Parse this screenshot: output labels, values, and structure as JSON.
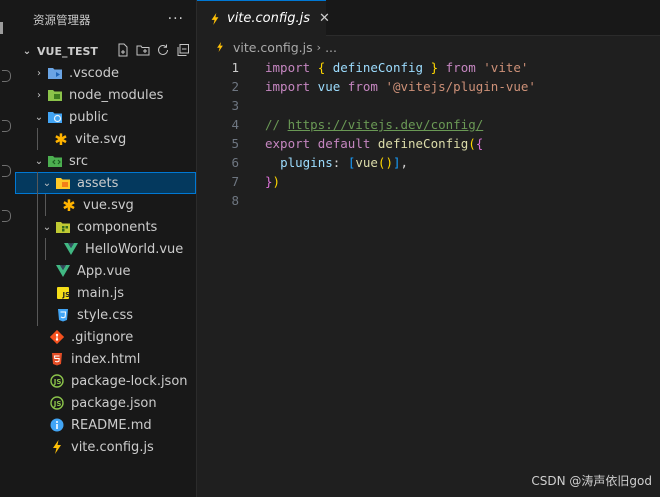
{
  "explorer": {
    "title": "资源管理器",
    "more": "···",
    "root": "VUE_TEST",
    "items": [
      {
        "label": ".vscode",
        "icon": "vscode-folder-icon",
        "chevron": "›",
        "depth": 1
      },
      {
        "label": "node_modules",
        "icon": "folder-icon",
        "chevron": "›",
        "depth": 1
      },
      {
        "label": "public",
        "icon": "public-folder-icon",
        "chevron": "⌄",
        "depth": 1
      },
      {
        "label": "vite.svg",
        "icon": "svg-file-icon",
        "chevron": "",
        "depth": 2
      },
      {
        "label": "src",
        "icon": "src-folder-icon",
        "chevron": "⌄",
        "depth": 1
      },
      {
        "label": "assets",
        "icon": "assets-folder-icon",
        "chevron": "⌄",
        "depth": 2
      },
      {
        "label": "vue.svg",
        "icon": "svg-file-icon",
        "chevron": "",
        "depth": 3
      },
      {
        "label": "components",
        "icon": "components-folder-icon",
        "chevron": "⌄",
        "depth": 2
      },
      {
        "label": "HelloWorld.vue",
        "icon": "vue-file-icon",
        "chevron": "",
        "depth": 3
      },
      {
        "label": "App.vue",
        "icon": "vue-file-icon",
        "chevron": "",
        "depth": 2
      },
      {
        "label": "main.js",
        "icon": "js-file-icon",
        "chevron": "",
        "depth": 2
      },
      {
        "label": "style.css",
        "icon": "css-file-icon",
        "chevron": "",
        "depth": 2
      },
      {
        "label": ".gitignore",
        "icon": "git-file-icon",
        "chevron": "",
        "depth": 1
      },
      {
        "label": "index.html",
        "icon": "html-file-icon",
        "chevron": "",
        "depth": 1
      },
      {
        "label": "package-lock.json",
        "icon": "json-file-icon",
        "chevron": "",
        "depth": 1
      },
      {
        "label": "package.json",
        "icon": "json-file-icon",
        "chevron": "",
        "depth": 1
      },
      {
        "label": "README.md",
        "icon": "info-file-icon",
        "chevron": "",
        "depth": 1
      },
      {
        "label": "vite.config.js",
        "icon": "vite-file-icon",
        "chevron": "",
        "depth": 1
      }
    ]
  },
  "editor": {
    "tab_label": "vite.config.js",
    "tab_close": "✕",
    "breadcrumb_file": "vite.config.js",
    "breadcrumb_sep": "›",
    "breadcrumb_more": "...",
    "line_numbers": [
      "1",
      "2",
      "3",
      "4",
      "5",
      "6",
      "7",
      "8"
    ],
    "code": {
      "l1_import": "import",
      "l1_ob": "{",
      "l1_name": " defineConfig ",
      "l1_cb": "}",
      "l1_from": "from",
      "l1_str": "'vite'",
      "l2_import": "import",
      "l2_name": " vue ",
      "l2_from": "from",
      "l2_str": "'@vitejs/plugin-vue'",
      "l4_slashes": "// ",
      "l4_url": "https://vitejs.dev/config/",
      "l5_export": "export",
      "l5_default": "default",
      "l5_fn": "defineConfig",
      "l5_op": "(",
      "l5_ob": "{",
      "l6_key": "plugins",
      "l6_colon": ": ",
      "l6_ob": "[",
      "l6_fn": "vue",
      "l6_parens": "()",
      "l6_cb": "]",
      "l6_comma": ",",
      "l7_cb": "}",
      "l7_cp": ")"
    }
  },
  "watermark": "CSDN @涛声依旧god",
  "colors": {
    "accent": "#0078d4",
    "selected_bg": "#04395e"
  }
}
